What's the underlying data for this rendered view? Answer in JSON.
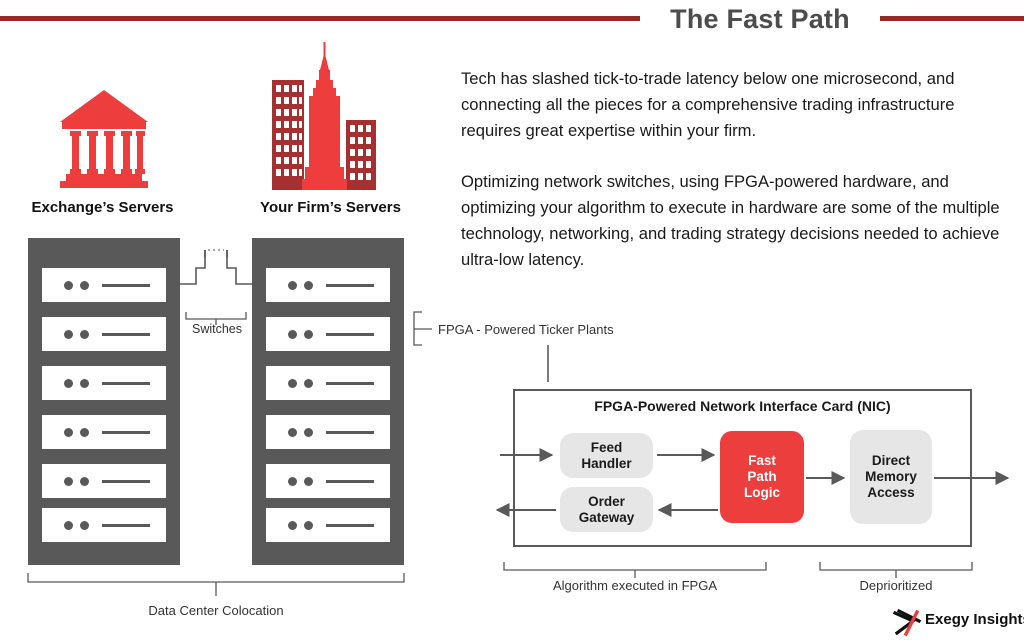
{
  "header": {
    "title": "The Fast Path",
    "rule_color": "#9B2729"
  },
  "copy": {
    "paragraph1": "Tech has slashed tick-to-trade latency below one microsecond, and connecting all the pieces for a comprehensive trading infrastructure requires great expertise within your firm.",
    "paragraph2": "Optimizing network switches, using FPGA-powered hardware, and optimizing your algorithm to execute in hardware are some of the multiple technology, networking, and trading strategy decisions needed to achieve ultra-low latency."
  },
  "icons": {
    "exchange_label": "Exchange’s Servers",
    "firm_label": "Your Firm’s Servers",
    "bank_icon": "bank-icon",
    "city_icon": "city-skyline-icon"
  },
  "diagram_left": {
    "switches_label": "Switches",
    "colocation_label": "Data Center Colocation",
    "ticker_plants_label": "FPGA - Powered Ticker Plants",
    "rack_count": 2,
    "blades_per_rack": 6,
    "rack_color": "#595959"
  },
  "nic": {
    "title": "FPGA-Powered Network Interface Card (NIC)",
    "nodes": [
      {
        "id": "feed-handler",
        "label": "Feed\nHandler",
        "line1": "Feed",
        "line2": "Handler",
        "color": "#e6e6e6"
      },
      {
        "id": "order-gateway",
        "label": "Order\nGateway",
        "line1": "Order",
        "line2": "Gateway",
        "color": "#e6e6e6"
      },
      {
        "id": "fast-path-logic",
        "line1": "Fast",
        "line2": "Path",
        "line3": "Logic",
        "color": "#ED3E3E"
      },
      {
        "id": "direct-memory-access",
        "line1": "Direct",
        "line2": "Memory",
        "line3": "Access",
        "color": "#e6e6e6"
      }
    ],
    "brace_algorithm": "Algorithm executed in FPGA",
    "brace_deprioritized": "Deprioritized"
  },
  "logo": {
    "text": "Exegy Insights",
    "mark": "exegy-x-mark",
    "accent": "#ED3E3E"
  }
}
